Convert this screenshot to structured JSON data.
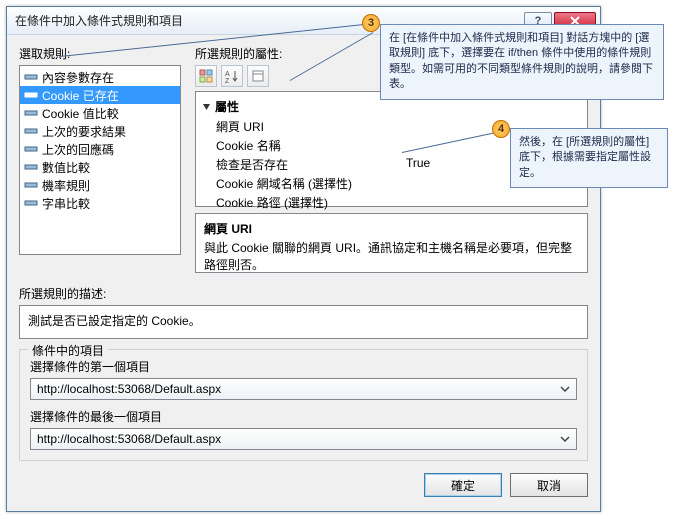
{
  "dialog": {
    "title": "在條件中加入條件式規則和項目"
  },
  "labels": {
    "select_rule": "選取規則:",
    "rule_properties": "所選規則的屬性:",
    "rule_description": "所選規則的描述:",
    "group_title": "條件中的項目",
    "first_item": "選擇條件的第一個項目",
    "last_item": "選擇條件的最後一個項目"
  },
  "rules": [
    "內容參數存在",
    "Cookie 已存在",
    "Cookie 值比較",
    "上次的要求結果",
    "上次的回應碼",
    "數值比較",
    "機率規則",
    "字串比較"
  ],
  "selected_rule_index": 1,
  "prop": {
    "section": "屬性",
    "rows": [
      {
        "name": "網頁 URI",
        "val": ""
      },
      {
        "name": "Cookie 名稱",
        "val": ""
      },
      {
        "name": "檢查是否存在",
        "val": "True"
      },
      {
        "name": "Cookie 網域名稱 (選擇性)",
        "val": ""
      },
      {
        "name": "Cookie 路徑 (選擇性)",
        "val": ""
      }
    ],
    "desc_title": "網頁 URI",
    "desc_body": "與此 Cookie 關聯的網頁 URI。通訊協定和主機名稱是必要項，但完整路徑則否。"
  },
  "description_box": "測試是否已設定指定的 Cookie。",
  "combo": {
    "first": "http://localhost:53068/Default.aspx",
    "last": "http://localhost:53068/Default.aspx"
  },
  "buttons": {
    "ok": "確定",
    "cancel": "取消"
  },
  "callouts": {
    "c3_num": "3",
    "c3": "在 [在條件中加入條件式規則和項目] 對話方塊中的 [選取規則] 底下，選擇要在 if/then 條件中使用的條件規則類型。如需可用的不同類型條件規則的說明，請參閱下表。",
    "c4_num": "4",
    "c4": "然後，在 [所選規則的屬性] 底下，根據需要指定屬性設定。"
  }
}
